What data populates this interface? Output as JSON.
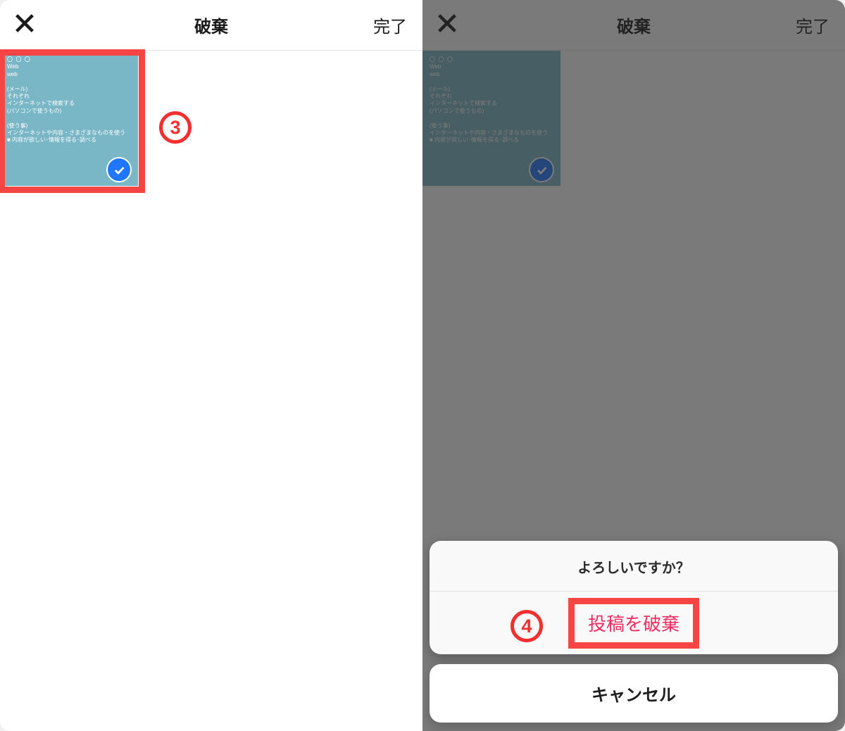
{
  "left": {
    "header": {
      "title": "破棄",
      "done": "完了"
    },
    "annot": "3",
    "thumb": {
      "text": "〇  〇  〇\nWeb\nweb\n\n(メール)\nそれぞれ\nインターネットで検索する\n(パソコンで使うもの)\n\n(使う事)\nインターネットや内容・さまざまなものを使う\n■ 内容が欲しい･情報を得る･調べる"
    }
  },
  "right": {
    "header": {
      "title": "破棄",
      "done": "完了"
    },
    "sheet": {
      "title": "よろしいですか？",
      "discard": "投稿を破棄",
      "cancel": "キャンセル"
    },
    "annot": "4"
  }
}
